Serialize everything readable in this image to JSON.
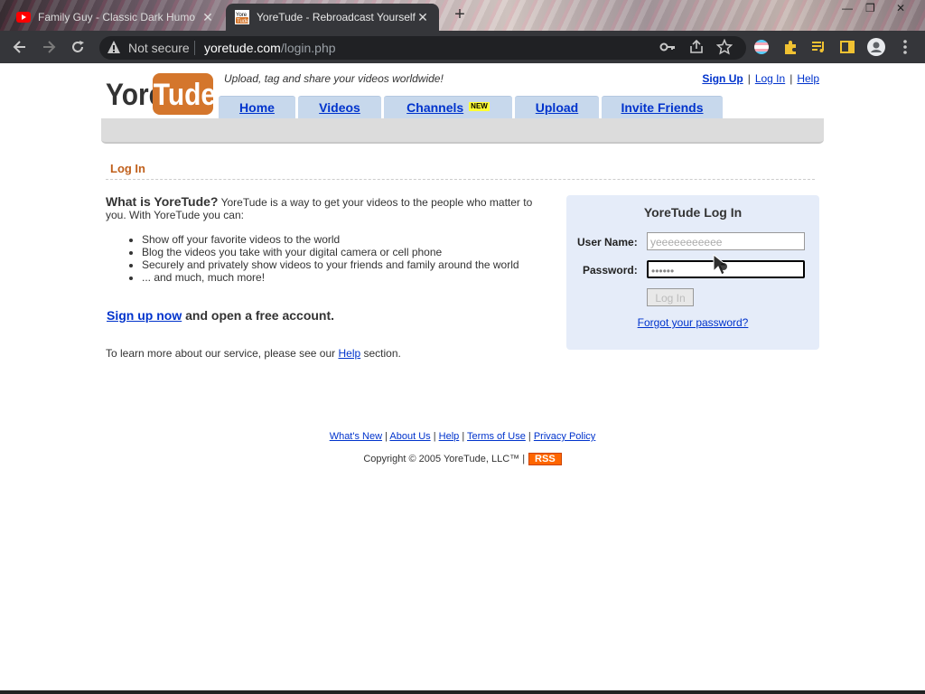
{
  "browser": {
    "inactive_tab_title": "Family Guy - Classic Dark Humo",
    "active_tab_title": "YoreTude - Rebroadcast Yourself.",
    "security_label": "Not secure",
    "url_host": "yoretude.com",
    "url_path": "/login.php"
  },
  "site": {
    "logo_text_left": "Yore",
    "logo_text_right": "Tude",
    "tagline": "Upload, tag and share your videos worldwide!",
    "top_links": [
      "Sign Up",
      "Log In",
      "Help"
    ],
    "nav_tabs": [
      {
        "label": "Home"
      },
      {
        "label": "Videos"
      },
      {
        "label": "Channels",
        "badge": "NEW"
      },
      {
        "label": "Upload"
      },
      {
        "label": "Invite Friends"
      }
    ]
  },
  "page": {
    "title": "Log In",
    "intro_heading": "What is YoreTude?",
    "intro_text": "YoreTude is a way to get your videos to the people who matter to you. With YoreTude you can:",
    "bullets": [
      "Show off your favorite videos to the world",
      "Blog the videos you take with your digital camera or cell phone",
      "Securely and privately show videos to your friends and family around the world",
      "... and much, much more!"
    ],
    "signup_link": "Sign up now",
    "signup_rest": " and open a free account.",
    "learn_prefix": "To learn more about our service, please see our ",
    "learn_link": "Help",
    "learn_suffix": " section."
  },
  "login": {
    "title": "YoreTude Log In",
    "username_label": "User Name:",
    "username_value": "yeeeeeeeeeee",
    "password_label": "Password:",
    "password_value": "••••••",
    "button": "Log In",
    "forgot": "Forgot your password?"
  },
  "footer": {
    "links": [
      "What's New",
      "About Us",
      "Help",
      "Terms of Use",
      "Privacy Policy"
    ],
    "copyright": "Copyright © 2005 YoreTude, LLC™ |",
    "rss": "RSS"
  },
  "colors": {
    "link": "#0033cc",
    "page_title": "#c0601c",
    "logo_orange": "#d4762c",
    "nav_tab": "#c7d8ec",
    "login_box": "#e5ecf9",
    "rss": "#ff6600"
  },
  "icons": [
    "youtube-favicon",
    "yoretude-favicon",
    "back-arrow-icon",
    "forward-arrow-icon",
    "reload-icon",
    "warning-icon",
    "key-icon",
    "share-icon",
    "star-icon",
    "flag-icon",
    "puzzle-icon",
    "media-icon",
    "sidebar-icon",
    "profile-icon",
    "menu-dots-icon",
    "cursor-icon"
  ]
}
